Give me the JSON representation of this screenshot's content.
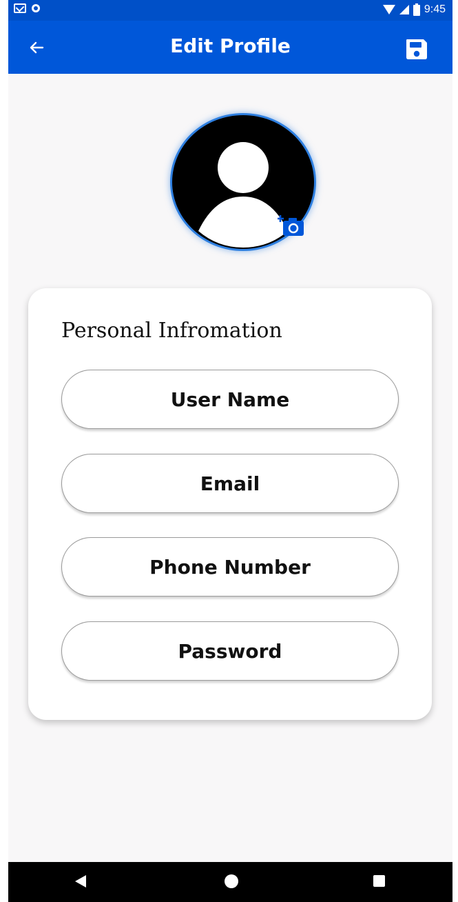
{
  "status_bar": {
    "time": "9:45",
    "left_icons": [
      "gmail-icon",
      "sync-icon"
    ],
    "right_icons": [
      "wifi-icon",
      "signal-icon",
      "battery-icon"
    ]
  },
  "app_bar": {
    "title": "Edit Profile",
    "back_icon": "arrow-left-icon",
    "save_icon": "save-floppy-icon",
    "background_color": "#0057d9"
  },
  "avatar": {
    "icon": "person-silhouette-icon",
    "badge_icon": "add-camera-icon",
    "border_color": "#2e7fe0"
  },
  "personal_info": {
    "heading": "Personal Infromation",
    "fields": [
      {
        "placeholder": "User Name"
      },
      {
        "placeholder": "Email"
      },
      {
        "placeholder": "Phone Number"
      },
      {
        "placeholder": "Password"
      }
    ]
  },
  "nav_bar": {
    "icons": [
      "nav-back-icon",
      "nav-home-icon",
      "nav-recents-icon"
    ]
  }
}
